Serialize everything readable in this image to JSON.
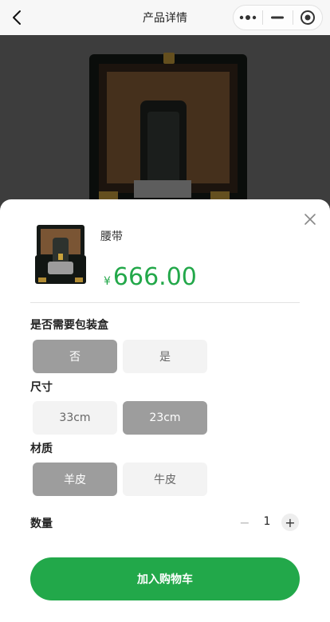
{
  "navbar": {
    "title": "产品详情",
    "back_icon": "chevron-left-icon",
    "capsule_icons": [
      "more-dots-icon",
      "minimize-icon",
      "record-icon"
    ]
  },
  "sheet": {
    "product_name": "腰带",
    "currency": "¥",
    "price": "666.00",
    "price_color": "#23a84a",
    "options": [
      {
        "title": "是否需要包装盒",
        "choices": [
          "否",
          "是"
        ],
        "selected": 0
      },
      {
        "title": "尺寸",
        "choices": [
          "33cm",
          "23cm"
        ],
        "selected": 1
      },
      {
        "title": "材质",
        "choices": [
          "羊皮",
          "牛皮"
        ],
        "selected": 0
      }
    ],
    "quantity_label": "数量",
    "quantity": "1",
    "minus": "−",
    "plus": "+",
    "add_to_cart": "加入购物车",
    "button_color": "#22a84a"
  }
}
